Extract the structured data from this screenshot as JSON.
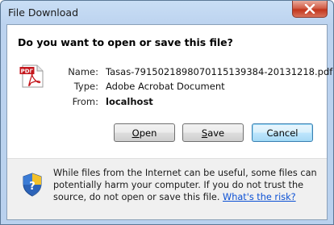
{
  "window": {
    "title": "File Download"
  },
  "dialog": {
    "question": "Do you want to open or save this file?",
    "fields": [
      {
        "label": "Name:",
        "value": "Tasas-7915021898070115139384-20131218.pdf"
      },
      {
        "label": "Type:",
        "value": "Adobe Acrobat Document"
      },
      {
        "label": "From:",
        "value": "localhost"
      }
    ],
    "buttons": {
      "open": {
        "pre": "",
        "accel": "O",
        "post": "pen"
      },
      "save": {
        "pre": "",
        "accel": "S",
        "post": "ave"
      },
      "cancel": "Cancel"
    },
    "file_icon_text": "PDF"
  },
  "footer": {
    "warning": "While files from the Internet can be useful, some files can potentially harm your computer. If you do not trust the source, do not open or save this file.",
    "link": "What's the risk?"
  },
  "icons": {
    "close": "close-icon",
    "file": "pdf-file-icon",
    "security": "security-shield-icon"
  }
}
